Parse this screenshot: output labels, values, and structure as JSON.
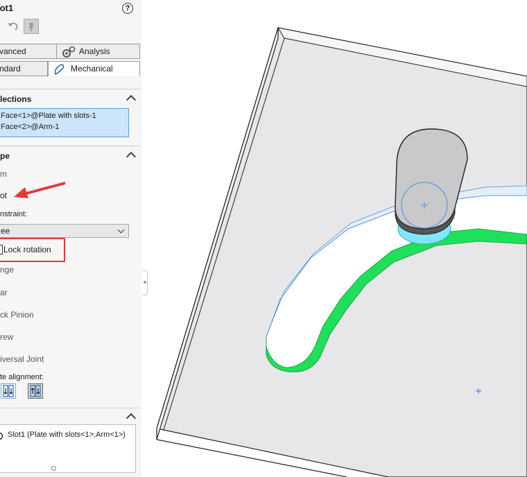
{
  "property_manager": {
    "title": "lot1",
    "help_label": "?",
    "tabs": {
      "advanced": "vanced",
      "analysis": "Analysis",
      "standard": "ndard",
      "mechanical": "Mechanical"
    },
    "selections": {
      "header": "lections",
      "items": [
        "Face<1>@Plate with slots-1",
        "Face<2>@Arm-1"
      ]
    },
    "type": {
      "header": "pe",
      "options": [
        "m",
        "ot"
      ]
    },
    "constraint": {
      "label": "nstraint:",
      "selected": "ee"
    },
    "lock_rotation": {
      "label": "Lock rotation",
      "checked": false
    },
    "more_options": [
      "nge",
      "ar",
      "ck Pinion",
      "rew",
      "iversal Joint"
    ],
    "mate_alignment": {
      "label": "te alignment:"
    },
    "mates": {
      "items": [
        "Slot1 (Plate with slots<1>,Arm<1>)"
      ]
    },
    "icons": [
      "help-icon",
      "undo-icon",
      "pin-icon",
      "gears-icon",
      "mechanical-icon",
      "chevron-up-icon",
      "chevron-down-icon",
      "aligned-icon",
      "anti-aligned-icon",
      "mate-slot-icon",
      "red-arrow-annotation"
    ]
  },
  "colors": {
    "selection_bg": "#cde5fb",
    "selection_border": "#5aa0df",
    "annotation_red": "#e5383b",
    "slot_face_green": "#1fe05a",
    "arm_face_cyan": "#7fe8ff",
    "plate_face": "#e7e7e9",
    "arm_body": "#c9c9cc"
  }
}
